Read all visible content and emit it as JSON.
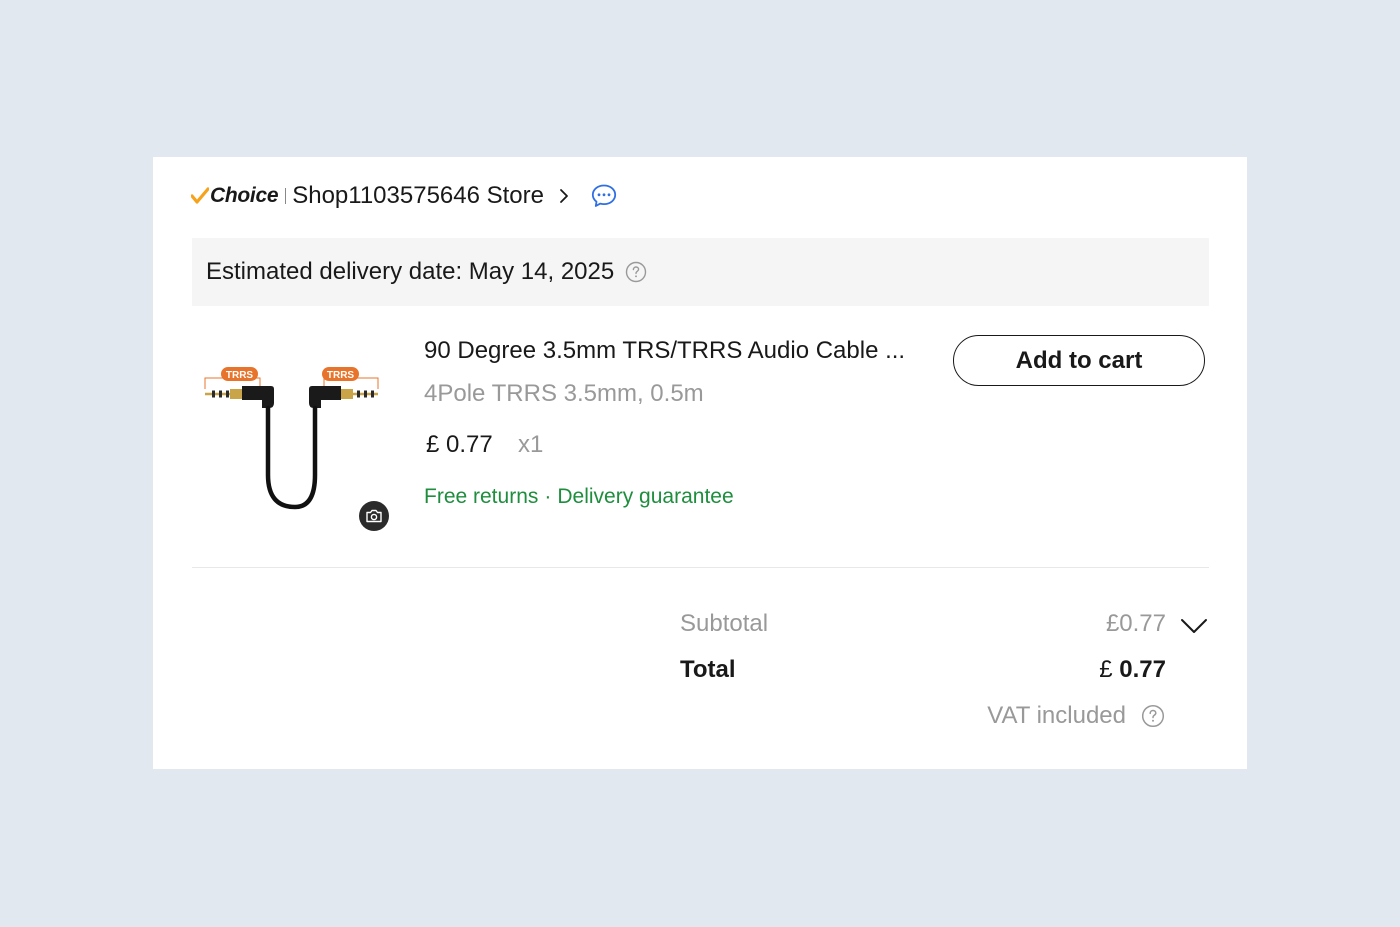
{
  "store": {
    "badge_label": "Choice",
    "name": "Shop1103575646 Store",
    "chevron_icon": "chevron-right-icon",
    "chat_icon": "chat-bubble-icon"
  },
  "delivery": {
    "text": "Estimated delivery date: May 14, 2025",
    "help_icon": "question-circle-icon"
  },
  "product": {
    "title": "90 Degree 3.5mm TRS/TRRS Audio Cable ...",
    "variant": "4Pole TRRS 3.5mm, 0.5m",
    "price": "£ 0.77",
    "quantity": "x1",
    "image_labels": [
      "TRRS",
      "TRRS"
    ],
    "benefits": [
      "Free returns",
      "Delivery guarantee"
    ],
    "benefit_separator": "·",
    "add_to_cart_label": "Add to cart",
    "camera_icon": "camera-icon"
  },
  "summary": {
    "subtotal_label": "Subtotal",
    "subtotal_value": "£0.77",
    "total_label": "Total",
    "total_currency": "£",
    "total_amount": "0.77",
    "vat_label": "VAT included"
  },
  "colors": {
    "background": "#e2e8f0",
    "card": "#ffffff",
    "delivery_bar": "#f5f5f5",
    "benefit_green": "#1e8e3e",
    "chat_blue": "#2f6fe4",
    "choice_check": "#f7a21b",
    "muted_text": "#999999"
  }
}
